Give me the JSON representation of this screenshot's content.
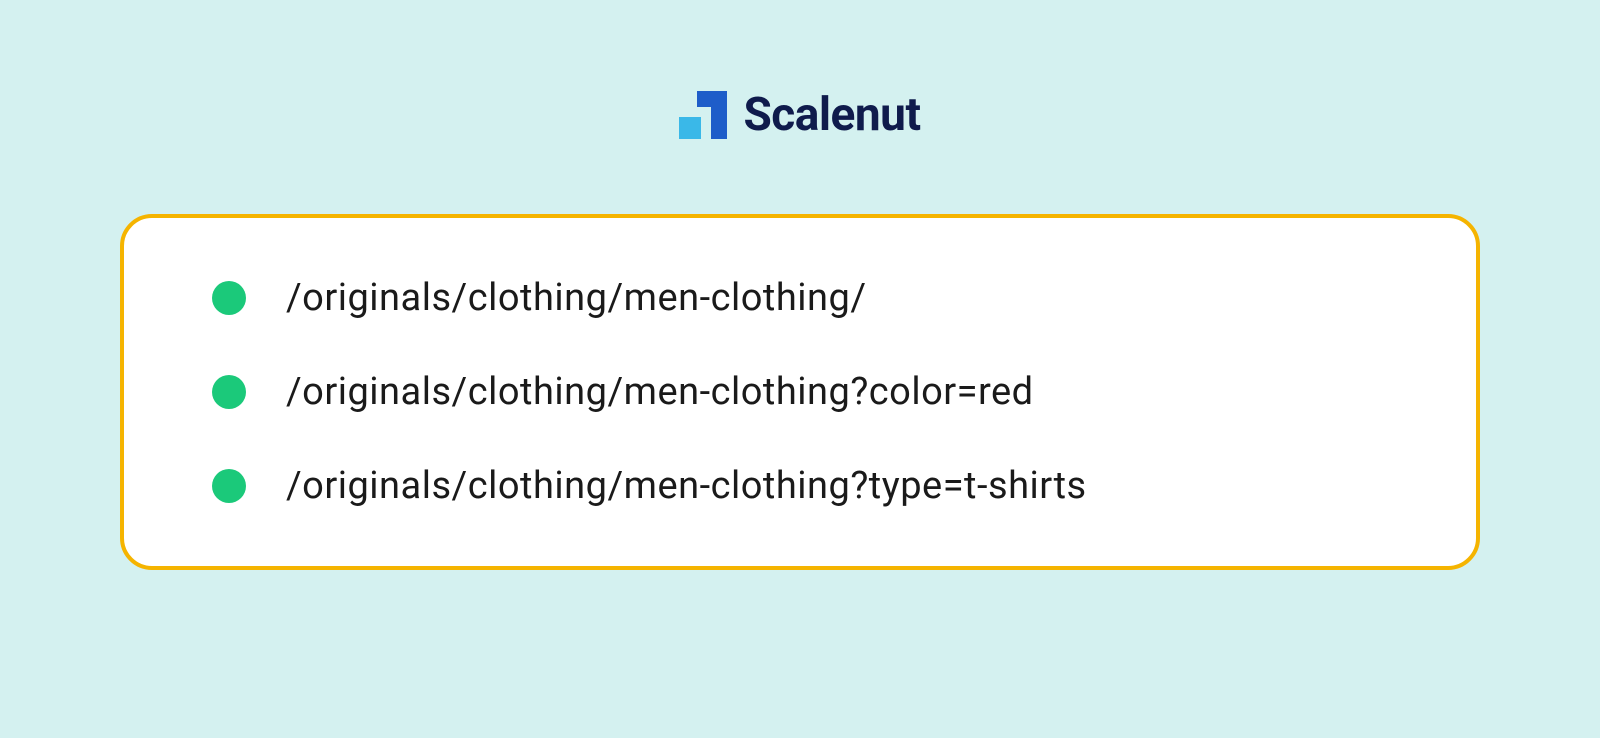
{
  "brand": {
    "name": "Scalenut"
  },
  "urls": [
    {
      "path": "/originals/clothing/men-clothing/"
    },
    {
      "path": "/originals/clothing/men-clothing?color=red"
    },
    {
      "path": "/originals/clothing/men-clothing?type=t-shirts"
    }
  ]
}
